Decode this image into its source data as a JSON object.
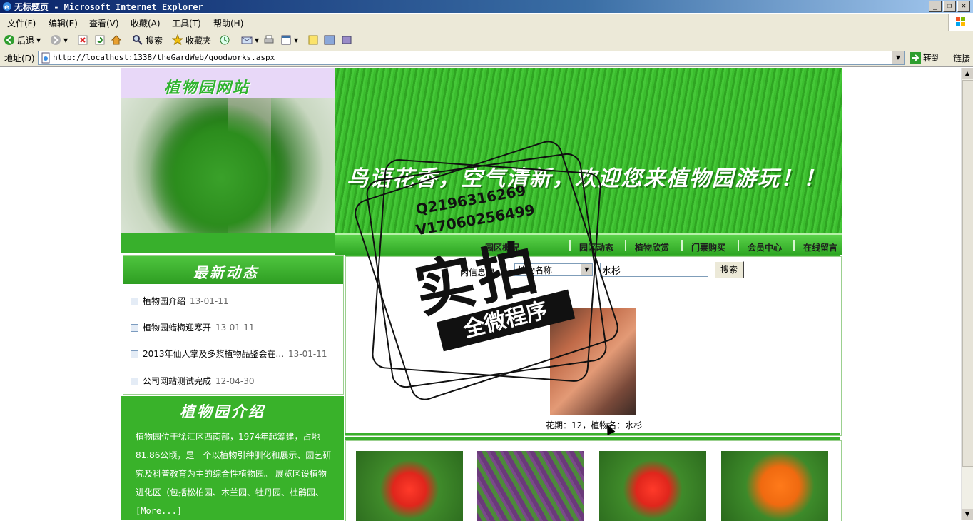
{
  "window": {
    "title": "无标题页 - Microsoft Internet Explorer",
    "buttons": {
      "minimize": "_",
      "restore": "❐",
      "close": "✕"
    }
  },
  "menu": [
    "文件(F)",
    "编辑(E)",
    "查看(V)",
    "收藏(A)",
    "工具(T)",
    "帮助(H)"
  ],
  "toolbar": {
    "back": "后退",
    "search": "搜索",
    "favorites": "收藏夹"
  },
  "address": {
    "label": "地址(D)",
    "url": "http://localhost:1338/theGardWeb/goodworks.aspx",
    "go": "转到",
    "links": "链接"
  },
  "site": {
    "title": "植物园网站",
    "slogan": "鸟语花香，空气清新，欢迎您来植物园游玩！！",
    "nav": [
      "园区概况",
      "园区动态",
      "植物欣赏",
      "门票购买",
      "会员中心",
      "在线留言"
    ]
  },
  "news": {
    "heading": "最新动态",
    "items": [
      {
        "title": "植物园介绍",
        "date": "13-01-11"
      },
      {
        "title": "植物园蜡梅迎寒开",
        "date": "13-01-11"
      },
      {
        "title": "2013年仙人掌及多浆植物品鉴会在...",
        "date": "13-01-11"
      },
      {
        "title": "公司网站测试完成",
        "date": "12-04-30"
      }
    ]
  },
  "intro": {
    "heading": "植物园介绍",
    "text": "植物园位于徐汇区西南部，1974年起筹建，占地81.86公顷，是一个以植物引种驯化和展示、园艺研究及科普教育为主的综合性植物园。 展览区设植物进化区（包括松柏园、木兰园、牡丹园、杜鹃园、",
    "more": "[More...]"
  },
  "search": {
    "label": "内信息搜",
    "select_value": "植物名称",
    "input_value": "水杉",
    "button": "搜索"
  },
  "feature": {
    "caption": "花期：12，植物名：水杉"
  },
  "watermark": {
    "qq": "Q2196316269",
    "vx": "V17060256499",
    "big": "实拍",
    "ribbon": "全微程序"
  },
  "colors": {
    "accent_green": "#39b22a",
    "title_bar": "#0a246a",
    "chrome": "#ece9d8"
  }
}
